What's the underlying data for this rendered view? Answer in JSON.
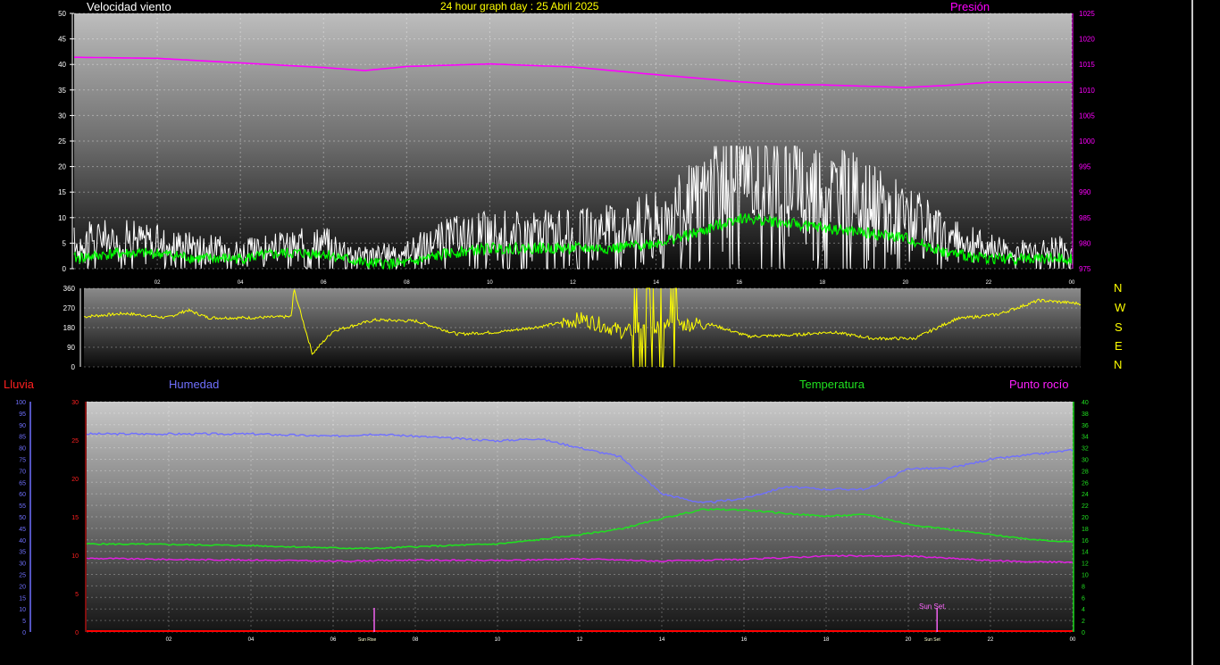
{
  "header": {
    "wind_speed_label": "Velocidad viento",
    "title": "24 hour graph day : 25 Abril 2025",
    "pressure_label": "Presión"
  },
  "compass": [
    "N",
    "W",
    "S",
    "E",
    "N"
  ],
  "legend2": {
    "rain_label": "Lluvia",
    "humidity_label": "Humedad",
    "temperature_label": "Temperatura",
    "dewpoint_label": "Punto rocío"
  },
  "markers": {
    "sunrise_label": "Sun Rise",
    "sunset_label": "Sun Set",
    "sunset_top_label": "Sun Set."
  },
  "colors": {
    "wind_gust": "#ffffff",
    "wind_avg": "#00ff00",
    "pressure": "#ff00ff",
    "direction": "#ffff00",
    "humidity": "#6f6fff",
    "temperature": "#22dd22",
    "dewpoint": "#e020e0",
    "rain": "#ff0000"
  },
  "chart_data": [
    {
      "type": "line",
      "name": "wind-pressure",
      "x_ticks": [
        "02",
        "04",
        "06",
        "08",
        "10",
        "12",
        "14",
        "16",
        "18",
        "20",
        "22",
        "00"
      ],
      "ylim_left": [
        0,
        50
      ],
      "yticks_left": [
        0,
        5,
        10,
        15,
        20,
        25,
        30,
        35,
        40,
        45,
        50
      ],
      "ylim_right": [
        975,
        1025
      ],
      "yticks_right": [
        975,
        980,
        985,
        990,
        995,
        1000,
        1005,
        1010,
        1015,
        1020,
        1025
      ],
      "series": [
        {
          "key": "gust",
          "x": [
            0,
            1,
            2,
            3,
            4,
            5,
            6,
            7,
            8,
            9,
            10,
            11,
            12,
            13,
            14,
            15,
            16,
            17,
            18,
            19,
            20,
            21,
            22,
            23,
            24
          ],
          "values": [
            6,
            7,
            6,
            5,
            4,
            5,
            6,
            3,
            4,
            7,
            8,
            8,
            8,
            9,
            11,
            15,
            21,
            20,
            18,
            15,
            12,
            7,
            5,
            4,
            5
          ]
        },
        {
          "key": "avg",
          "x": [
            0,
            1,
            2,
            3,
            4,
            5,
            6,
            7,
            8,
            9,
            10,
            11,
            12,
            13,
            14,
            15,
            16,
            17,
            18,
            19,
            20,
            21,
            22,
            23,
            24
          ],
          "values": [
            2,
            3,
            3,
            2,
            2,
            3,
            3,
            1,
            1,
            3,
            4,
            4,
            4,
            4,
            5,
            7,
            10,
            9,
            8,
            7,
            6,
            3,
            2,
            2,
            2
          ]
        },
        {
          "name": "Presión",
          "key": "pressure",
          "x": [
            0,
            2,
            4,
            6,
            7,
            8,
            10,
            12,
            14,
            16,
            17,
            18,
            20,
            21,
            22,
            24
          ],
          "values": [
            1016.4,
            1016.2,
            1015.3,
            1014.4,
            1013.8,
            1014.6,
            1015.1,
            1014.5,
            1013,
            1011.6,
            1011.1,
            1011,
            1010.5,
            1010.9,
            1011.5,
            1011.5
          ]
        }
      ]
    },
    {
      "type": "line",
      "name": "wind-direction",
      "ylim": [
        0,
        360
      ],
      "yticks": [
        0,
        90,
        180,
        270,
        360
      ],
      "series": [
        {
          "key": "direction",
          "x": [
            0,
            1,
            2,
            2.5,
            3,
            4,
            5,
            5.05,
            5.5,
            6,
            7,
            8,
            9,
            10,
            11,
            12,
            13,
            14,
            15,
            16,
            17,
            18,
            19,
            20,
            21,
            22,
            23,
            24
          ],
          "values": [
            230,
            245,
            225,
            260,
            225,
            225,
            230,
            360,
            60,
            165,
            215,
            210,
            150,
            160,
            185,
            220,
            160,
            190,
            200,
            140,
            145,
            160,
            130,
            130,
            220,
            240,
            305,
            290
          ]
        }
      ]
    },
    {
      "type": "line",
      "name": "humidity-temperature",
      "x_ticks": [
        "02",
        "04",
        "06",
        "08",
        "10",
        "12",
        "14",
        "16",
        "18",
        "20",
        "22",
        "00"
      ],
      "ylim_humidity": [
        0,
        100
      ],
      "yticks_humidity": [
        0,
        5,
        10,
        15,
        20,
        25,
        30,
        35,
        40,
        45,
        50,
        55,
        60,
        65,
        70,
        75,
        80,
        85,
        90,
        95,
        100
      ],
      "ylim_rain": [
        0,
        30
      ],
      "yticks_rain": [
        0,
        5,
        10,
        15,
        20,
        25,
        30
      ],
      "ylim_temp": [
        0,
        40
      ],
      "yticks_temp": [
        0,
        2,
        4,
        6,
        8,
        10,
        12,
        14,
        16,
        18,
        20,
        22,
        24,
        26,
        28,
        30,
        32,
        34,
        36,
        38,
        40
      ],
      "series": [
        {
          "name": "Humedad",
          "key": "humidity",
          "x": [
            0,
            2,
            4,
            6,
            7,
            8,
            9,
            10,
            11,
            12,
            13,
            14,
            15,
            16,
            17,
            18,
            19,
            20,
            21,
            22,
            23,
            24
          ],
          "values": [
            86,
            86,
            86,
            85,
            86,
            85,
            84,
            83,
            84,
            80,
            76,
            60,
            56,
            58,
            63,
            62,
            62,
            71,
            71,
            75,
            77,
            79
          ]
        },
        {
          "name": "Temperatura",
          "key": "temperature",
          "x": [
            0,
            2,
            4,
            6,
            7,
            8,
            10,
            11,
            12,
            13,
            14,
            15,
            16,
            17,
            18,
            19,
            20,
            21,
            22,
            23,
            24
          ],
          "values": [
            15.3,
            15.2,
            15,
            14.6,
            14.5,
            14.8,
            15.3,
            16,
            16.9,
            17.9,
            19.7,
            21.3,
            21.2,
            20.6,
            20.1,
            20.4,
            18.7,
            17.8,
            16.9,
            16.1,
            15.6
          ]
        },
        {
          "name": "Punto rocío",
          "key": "dewpoint",
          "x": [
            0,
            2,
            4,
            6,
            8,
            10,
            12,
            14,
            16,
            18,
            20,
            22,
            23,
            24
          ],
          "values": [
            12.8,
            12.6,
            12.5,
            12.3,
            12.5,
            12.4,
            12.7,
            12.3,
            12.6,
            13.2,
            13.2,
            12.4,
            12.2,
            12.1
          ]
        },
        {
          "name": "Lluvia",
          "key": "rain",
          "x": [
            0,
            24
          ],
          "values": [
            0,
            0
          ]
        }
      ],
      "events": [
        {
          "key": "sunrise",
          "x": 7.0
        },
        {
          "key": "sunset",
          "x": 20.7
        }
      ]
    }
  ]
}
